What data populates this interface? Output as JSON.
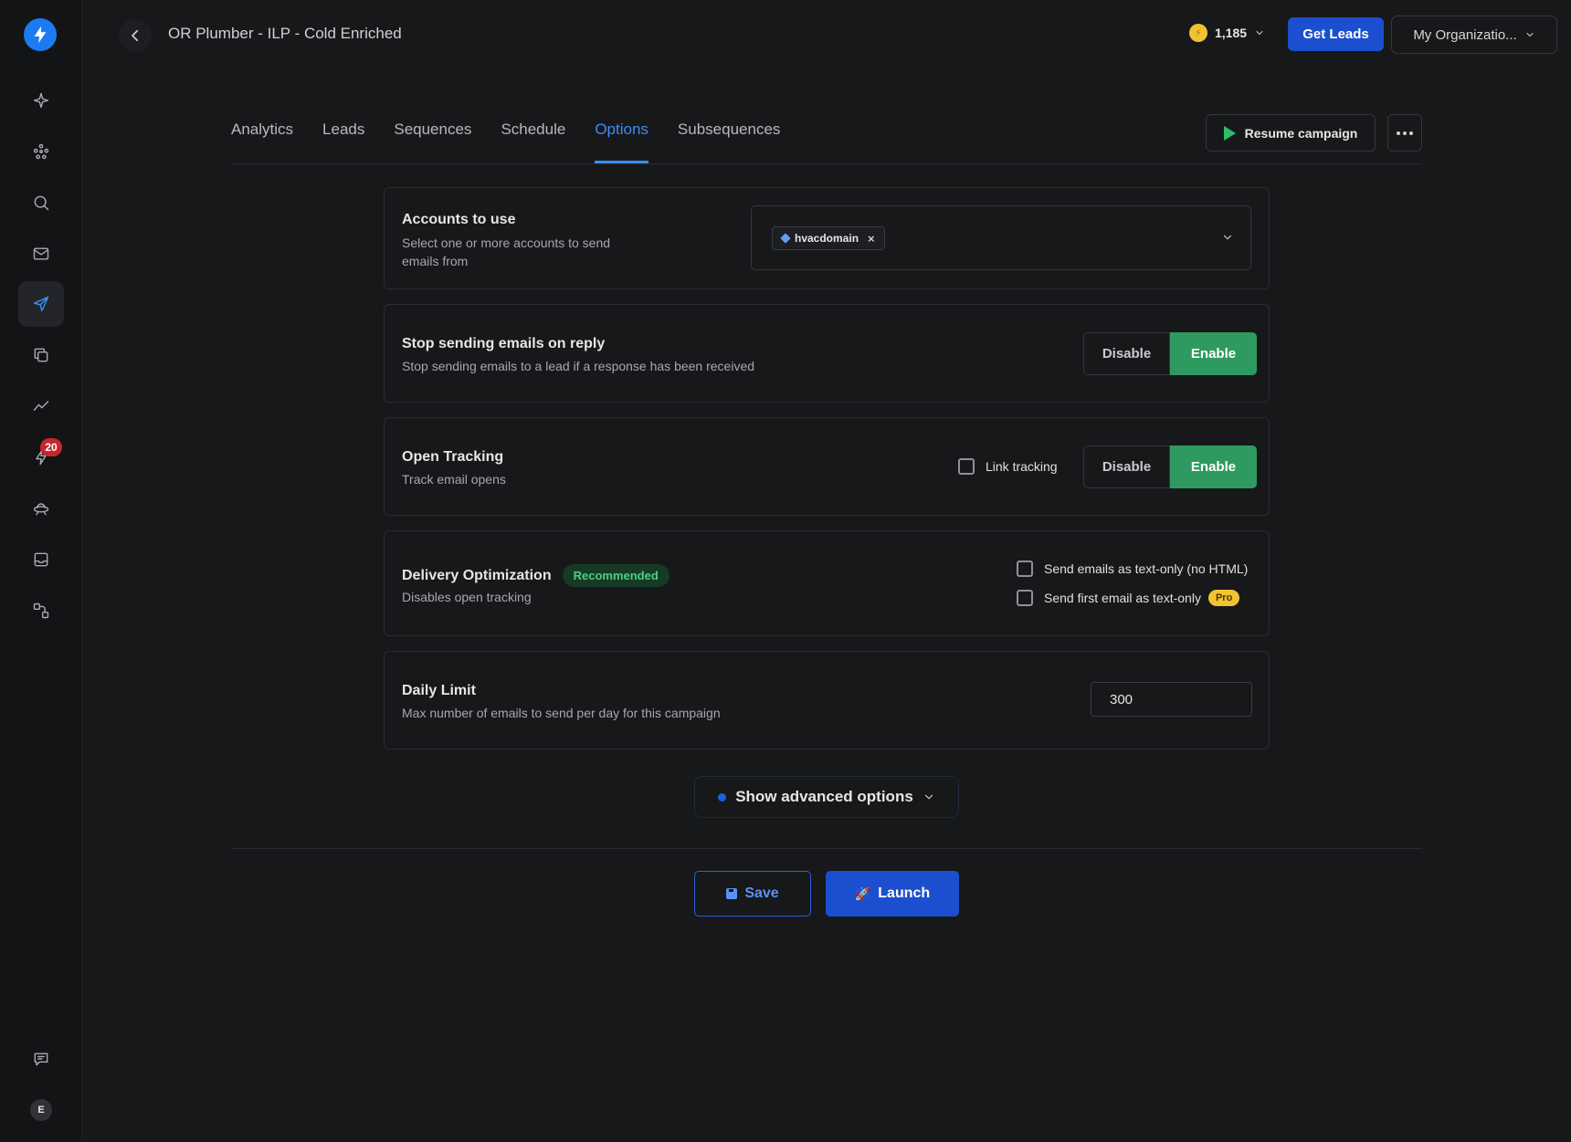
{
  "header": {
    "campaign_title": "OR Plumber - ILP - Cold Enriched",
    "credits": "1,185",
    "get_leads_label": "Get Leads",
    "organization_label": "My Organizatio..."
  },
  "sidebar": {
    "notifications_badge": "20",
    "user_initial": "E",
    "icons": [
      "sparkle-icon",
      "network-icon",
      "search-icon",
      "mail-icon",
      "send-icon",
      "copy-icon",
      "analytics-icon",
      "bolt-icon",
      "ufo-icon",
      "inbox-icon",
      "integrations-icon",
      "feedback-icon"
    ]
  },
  "tabs": [
    {
      "label": "Analytics",
      "active": false
    },
    {
      "label": "Leads",
      "active": false
    },
    {
      "label": "Sequences",
      "active": false
    },
    {
      "label": "Schedule",
      "active": false
    },
    {
      "label": "Options",
      "active": true
    },
    {
      "label": "Subsequences",
      "active": false
    }
  ],
  "actions": {
    "resume_label": "Resume campaign"
  },
  "accounts": {
    "title": "Accounts to use",
    "description": "Select one or more accounts to send emails from",
    "selected_account": "hvacdomain"
  },
  "stop_on_reply": {
    "title": "Stop sending emails on reply",
    "description": "Stop sending emails to a lead if a response has been received",
    "disable_label": "Disable",
    "enable_label": "Enable",
    "value": "Enable"
  },
  "open_tracking": {
    "title": "Open Tracking",
    "description": "Track email opens",
    "link_tracking_label": "Link tracking",
    "link_tracking_checked": false,
    "disable_label": "Disable",
    "enable_label": "Enable",
    "value": "Enable"
  },
  "delivery": {
    "title": "Delivery Optimization",
    "badge": "Recommended",
    "description": "Disables open tracking",
    "text_only_label": "Send emails as text-only (no HTML)",
    "first_text_only_label": "Send first email as text-only",
    "pro_badge": "Pro",
    "text_only_checked": false,
    "first_text_only_checked": false
  },
  "daily_limit": {
    "title": "Daily Limit",
    "description": "Max number of emails to send per day for this campaign",
    "value": "300"
  },
  "advanced_label": "Show advanced options",
  "footer": {
    "save_label": "Save",
    "launch_label": "Launch"
  },
  "colors": {
    "accent": "#3b8df5",
    "primary_button": "#1c4fd0",
    "enable_green": "#2f9a5f",
    "background": "#17181a"
  }
}
